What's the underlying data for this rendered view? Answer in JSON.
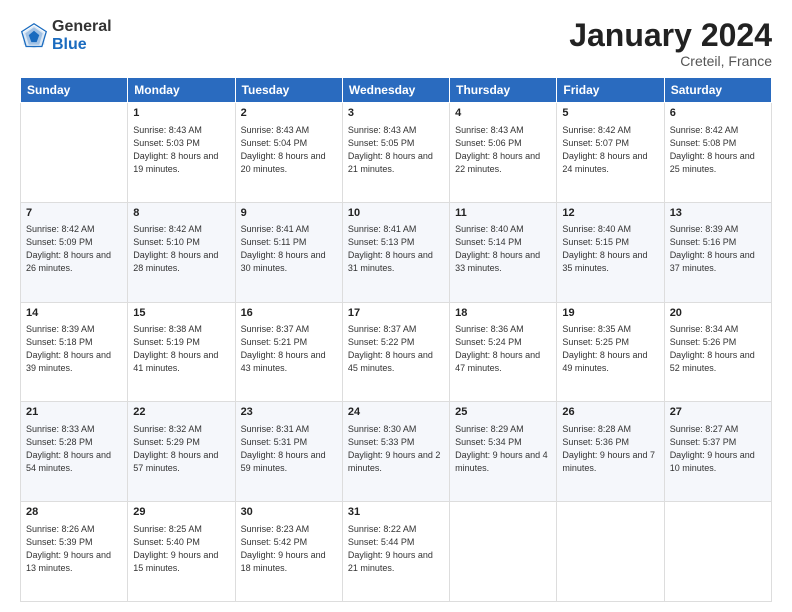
{
  "header": {
    "logo_general": "General",
    "logo_blue": "Blue",
    "title": "January 2024",
    "subtitle": "Creteil, France"
  },
  "weekdays": [
    "Sunday",
    "Monday",
    "Tuesday",
    "Wednesday",
    "Thursday",
    "Friday",
    "Saturday"
  ],
  "weeks": [
    [
      {
        "day": "",
        "sunrise": "",
        "sunset": "",
        "daylight": ""
      },
      {
        "day": "1",
        "sunrise": "Sunrise: 8:43 AM",
        "sunset": "Sunset: 5:03 PM",
        "daylight": "Daylight: 8 hours and 19 minutes."
      },
      {
        "day": "2",
        "sunrise": "Sunrise: 8:43 AM",
        "sunset": "Sunset: 5:04 PM",
        "daylight": "Daylight: 8 hours and 20 minutes."
      },
      {
        "day": "3",
        "sunrise": "Sunrise: 8:43 AM",
        "sunset": "Sunset: 5:05 PM",
        "daylight": "Daylight: 8 hours and 21 minutes."
      },
      {
        "day": "4",
        "sunrise": "Sunrise: 8:43 AM",
        "sunset": "Sunset: 5:06 PM",
        "daylight": "Daylight: 8 hours and 22 minutes."
      },
      {
        "day": "5",
        "sunrise": "Sunrise: 8:42 AM",
        "sunset": "Sunset: 5:07 PM",
        "daylight": "Daylight: 8 hours and 24 minutes."
      },
      {
        "day": "6",
        "sunrise": "Sunrise: 8:42 AM",
        "sunset": "Sunset: 5:08 PM",
        "daylight": "Daylight: 8 hours and 25 minutes."
      }
    ],
    [
      {
        "day": "7",
        "sunrise": "Sunrise: 8:42 AM",
        "sunset": "Sunset: 5:09 PM",
        "daylight": "Daylight: 8 hours and 26 minutes."
      },
      {
        "day": "8",
        "sunrise": "Sunrise: 8:42 AM",
        "sunset": "Sunset: 5:10 PM",
        "daylight": "Daylight: 8 hours and 28 minutes."
      },
      {
        "day": "9",
        "sunrise": "Sunrise: 8:41 AM",
        "sunset": "Sunset: 5:11 PM",
        "daylight": "Daylight: 8 hours and 30 minutes."
      },
      {
        "day": "10",
        "sunrise": "Sunrise: 8:41 AM",
        "sunset": "Sunset: 5:13 PM",
        "daylight": "Daylight: 8 hours and 31 minutes."
      },
      {
        "day": "11",
        "sunrise": "Sunrise: 8:40 AM",
        "sunset": "Sunset: 5:14 PM",
        "daylight": "Daylight: 8 hours and 33 minutes."
      },
      {
        "day": "12",
        "sunrise": "Sunrise: 8:40 AM",
        "sunset": "Sunset: 5:15 PM",
        "daylight": "Daylight: 8 hours and 35 minutes."
      },
      {
        "day": "13",
        "sunrise": "Sunrise: 8:39 AM",
        "sunset": "Sunset: 5:16 PM",
        "daylight": "Daylight: 8 hours and 37 minutes."
      }
    ],
    [
      {
        "day": "14",
        "sunrise": "Sunrise: 8:39 AM",
        "sunset": "Sunset: 5:18 PM",
        "daylight": "Daylight: 8 hours and 39 minutes."
      },
      {
        "day": "15",
        "sunrise": "Sunrise: 8:38 AM",
        "sunset": "Sunset: 5:19 PM",
        "daylight": "Daylight: 8 hours and 41 minutes."
      },
      {
        "day": "16",
        "sunrise": "Sunrise: 8:37 AM",
        "sunset": "Sunset: 5:21 PM",
        "daylight": "Daylight: 8 hours and 43 minutes."
      },
      {
        "day": "17",
        "sunrise": "Sunrise: 8:37 AM",
        "sunset": "Sunset: 5:22 PM",
        "daylight": "Daylight: 8 hours and 45 minutes."
      },
      {
        "day": "18",
        "sunrise": "Sunrise: 8:36 AM",
        "sunset": "Sunset: 5:24 PM",
        "daylight": "Daylight: 8 hours and 47 minutes."
      },
      {
        "day": "19",
        "sunrise": "Sunrise: 8:35 AM",
        "sunset": "Sunset: 5:25 PM",
        "daylight": "Daylight: 8 hours and 49 minutes."
      },
      {
        "day": "20",
        "sunrise": "Sunrise: 8:34 AM",
        "sunset": "Sunset: 5:26 PM",
        "daylight": "Daylight: 8 hours and 52 minutes."
      }
    ],
    [
      {
        "day": "21",
        "sunrise": "Sunrise: 8:33 AM",
        "sunset": "Sunset: 5:28 PM",
        "daylight": "Daylight: 8 hours and 54 minutes."
      },
      {
        "day": "22",
        "sunrise": "Sunrise: 8:32 AM",
        "sunset": "Sunset: 5:29 PM",
        "daylight": "Daylight: 8 hours and 57 minutes."
      },
      {
        "day": "23",
        "sunrise": "Sunrise: 8:31 AM",
        "sunset": "Sunset: 5:31 PM",
        "daylight": "Daylight: 8 hours and 59 minutes."
      },
      {
        "day": "24",
        "sunrise": "Sunrise: 8:30 AM",
        "sunset": "Sunset: 5:33 PM",
        "daylight": "Daylight: 9 hours and 2 minutes."
      },
      {
        "day": "25",
        "sunrise": "Sunrise: 8:29 AM",
        "sunset": "Sunset: 5:34 PM",
        "daylight": "Daylight: 9 hours and 4 minutes."
      },
      {
        "day": "26",
        "sunrise": "Sunrise: 8:28 AM",
        "sunset": "Sunset: 5:36 PM",
        "daylight": "Daylight: 9 hours and 7 minutes."
      },
      {
        "day": "27",
        "sunrise": "Sunrise: 8:27 AM",
        "sunset": "Sunset: 5:37 PM",
        "daylight": "Daylight: 9 hours and 10 minutes."
      }
    ],
    [
      {
        "day": "28",
        "sunrise": "Sunrise: 8:26 AM",
        "sunset": "Sunset: 5:39 PM",
        "daylight": "Daylight: 9 hours and 13 minutes."
      },
      {
        "day": "29",
        "sunrise": "Sunrise: 8:25 AM",
        "sunset": "Sunset: 5:40 PM",
        "daylight": "Daylight: 9 hours and 15 minutes."
      },
      {
        "day": "30",
        "sunrise": "Sunrise: 8:23 AM",
        "sunset": "Sunset: 5:42 PM",
        "daylight": "Daylight: 9 hours and 18 minutes."
      },
      {
        "day": "31",
        "sunrise": "Sunrise: 8:22 AM",
        "sunset": "Sunset: 5:44 PM",
        "daylight": "Daylight: 9 hours and 21 minutes."
      },
      {
        "day": "",
        "sunrise": "",
        "sunset": "",
        "daylight": ""
      },
      {
        "day": "",
        "sunrise": "",
        "sunset": "",
        "daylight": ""
      },
      {
        "day": "",
        "sunrise": "",
        "sunset": "",
        "daylight": ""
      }
    ]
  ]
}
